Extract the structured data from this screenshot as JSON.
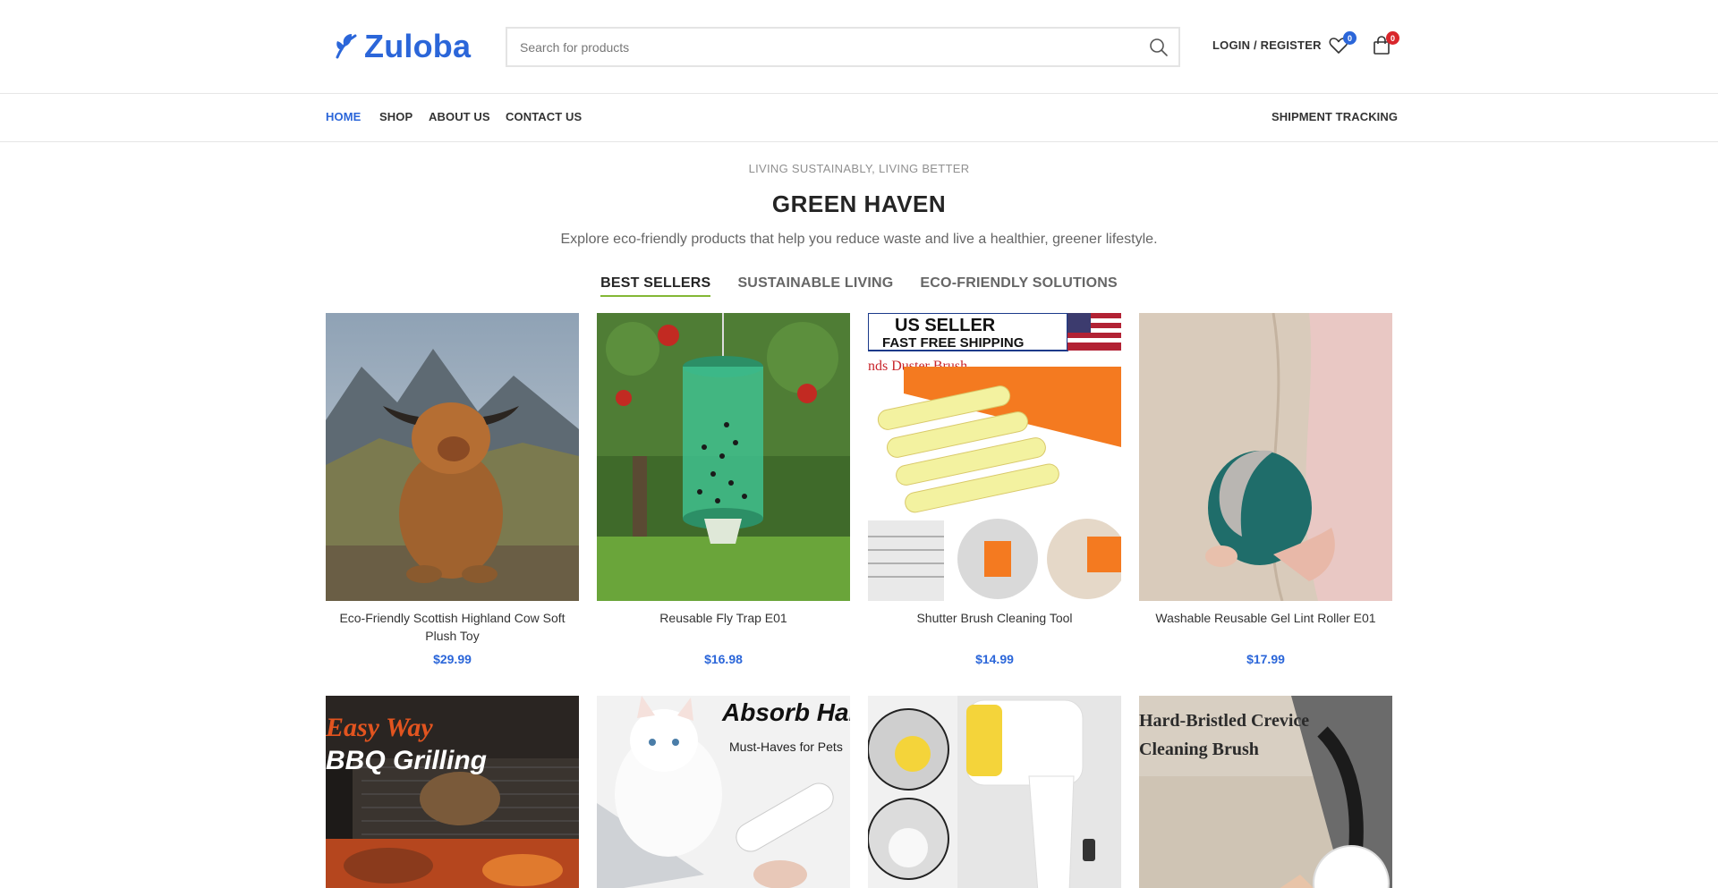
{
  "header": {
    "logo_text": "Zuloba",
    "search": {
      "placeholder": "Search for products",
      "value": ""
    },
    "login_label": "LOGIN / REGISTER",
    "wishlist_count": "0",
    "cart_count": "0"
  },
  "nav": {
    "items": [
      "HOME",
      "SHOP",
      "ABOUT US",
      "CONTACT US"
    ],
    "right": "SHIPMENT TRACKING"
  },
  "intro": {
    "subtitle": "LIVING SUSTAINABLY, LIVING BETTER",
    "title": "GREEN HAVEN",
    "description": "Explore eco-friendly products that help you reduce waste and live a healthier, greener lifestyle."
  },
  "tabs": [
    "BEST SELLERS",
    "SUSTAINABLE LIVING",
    "ECO-FRIENDLY SOLUTIONS"
  ],
  "products": [
    {
      "name": "Eco-Friendly Scottish Highland Cow Soft Plush Toy",
      "price": "$29.99"
    },
    {
      "name": "Reusable Fly Trap E01",
      "price": "$16.98"
    },
    {
      "name": "Shutter Brush Cleaning Tool",
      "price": "$14.99"
    },
    {
      "name": "Washable Reusable Gel Lint Roller E01",
      "price": "$17.99"
    }
  ],
  "product_image_text": {
    "shutter_banner_1": "US SELLER",
    "shutter_banner_2": "FAST FREE SHIPPING",
    "shutter_caption": "nds Duster Brush",
    "bbq_1": "Easy Way",
    "bbq_2": "BBQ Grilling",
    "cat_1": "Absorb Hair",
    "cat_2": "Must-Haves for Pets",
    "crevice_1": "Hard-Bristled Crevice",
    "crevice_2": "Cleaning Brush"
  },
  "colors": {
    "accent": "#2b66d9",
    "tab_underline": "#83b735",
    "badge_red": "#d9262b"
  }
}
